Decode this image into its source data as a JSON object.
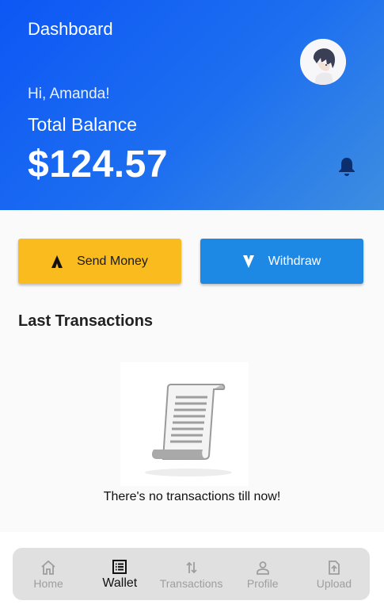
{
  "header": {
    "title": "Dashboard",
    "greeting": "Hi, Amanda!",
    "balance_label": "Total Balance",
    "balance": "$124.57",
    "avatar_icon": "user-avatar",
    "bell_icon": "bell-icon"
  },
  "actions": {
    "send_label": "Send Money",
    "withdraw_label": "Withdraw"
  },
  "transactions": {
    "title": "Last Transactions",
    "empty_text": "There's no transactions till now!"
  },
  "nav": {
    "items": [
      {
        "label": "Home",
        "icon": "home-icon",
        "active": false
      },
      {
        "label": "Wallet",
        "icon": "wallet-icon",
        "active": true
      },
      {
        "label": "Transactions",
        "icon": "transactions-icon",
        "active": false
      },
      {
        "label": "Profile",
        "icon": "profile-icon",
        "active": false
      },
      {
        "label": "Upload",
        "icon": "upload-icon",
        "active": false
      }
    ]
  },
  "colors": {
    "header_start": "#0d57f5",
    "header_end": "#3d8ee0",
    "send_button": "#fabb1e",
    "withdraw_button": "#1e88e5"
  }
}
